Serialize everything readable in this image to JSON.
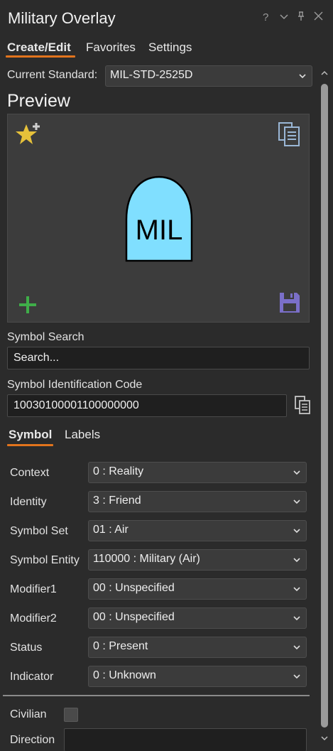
{
  "window": {
    "title": "Military Overlay",
    "controls": [
      "?",
      "⌄",
      "🖈",
      "✕"
    ]
  },
  "main_tabs": [
    {
      "label": "Create/Edit",
      "active": true
    },
    {
      "label": "Favorites",
      "active": false
    },
    {
      "label": "Settings",
      "active": false
    }
  ],
  "standard": {
    "label": "Current Standard:",
    "value": "MIL-STD-2525D"
  },
  "preview": {
    "title": "Preview",
    "symbol_text": "MIL",
    "symbol_color": "#80dfff"
  },
  "search": {
    "label": "Symbol Search",
    "placeholder": "Search..."
  },
  "sidc": {
    "label": "Symbol Identification Code",
    "value": "10030100001100000000"
  },
  "sub_tabs": [
    {
      "label": "Symbol",
      "active": true
    },
    {
      "label": "Labels",
      "active": false
    }
  ],
  "fields": [
    {
      "label": "Context",
      "value": "0 : Reality"
    },
    {
      "label": "Identity",
      "value": "3 : Friend"
    },
    {
      "label": "Symbol Set",
      "value": "01 : Air"
    },
    {
      "label": "Symbol Entity",
      "value": "110000 : Military (Air)"
    },
    {
      "label": "Modifier1",
      "value": "00 : Unspecified"
    },
    {
      "label": "Modifier2",
      "value": "00 : Unspecified"
    },
    {
      "label": "Status",
      "value": "0 : Present"
    },
    {
      "label": "Indicator",
      "value": "0 : Unknown"
    }
  ],
  "civilian": {
    "label": "Civilian",
    "checked": false
  },
  "direction": {
    "label": "Direction",
    "value": ""
  },
  "colors": {
    "accent": "#e2741d",
    "star": "#e6c13a",
    "add": "#3fae49",
    "save": "#7a6fc8"
  }
}
